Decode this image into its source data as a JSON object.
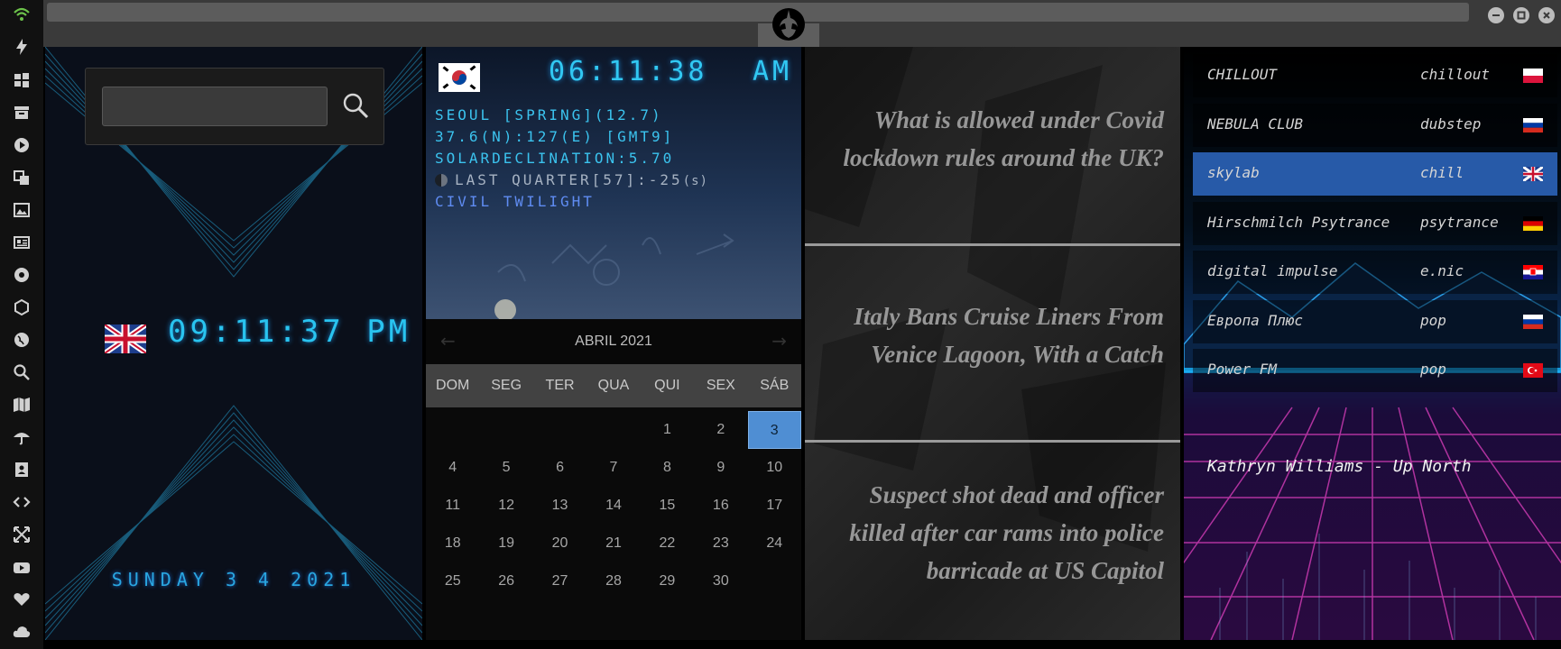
{
  "sidebar": {
    "icons": [
      "wifi-icon",
      "bolt-icon",
      "windows-icon",
      "archive-icon",
      "play-icon",
      "translate-icon",
      "image-icon",
      "news-icon",
      "rebel-icon",
      "hexagon-icon",
      "globe-icon",
      "search-icon",
      "map-icon",
      "umbrella-icon",
      "contacts-icon",
      "code-icon",
      "expand-icon",
      "youtube-icon",
      "heart-icon",
      "cloud-icon"
    ]
  },
  "colors": {
    "accent": "#29c4f0",
    "wifi": "#6cc24a",
    "selected": "#275aa8"
  },
  "clock": {
    "search": {
      "value": "",
      "placeholder": ""
    },
    "flag": "uk",
    "time": "09:11:37  PM",
    "date": "SUNDAY 3 4 2021"
  },
  "world": {
    "flag": "south-korea",
    "time": "06:11:38",
    "ampm": "AM",
    "city_line": "SEOUL [SPRING](12.7)",
    "coords_line": "37.6(N):127(E) [GMT9]",
    "declination_line": "SOLARDECLINATION:5.70",
    "moon_line": "LAST QUARTER[57]:-25",
    "moon_unit": "(s)",
    "twilight_line": "CIVIL TWILIGHT"
  },
  "calendar": {
    "title": "ABRIL 2021",
    "prev": "←",
    "next": "→",
    "weekdays": [
      "DOM",
      "SEG",
      "TER",
      "QUA",
      "QUI",
      "SEX",
      "SÁB"
    ],
    "rows": [
      [
        "",
        "",
        "",
        "",
        "1",
        "2",
        "3"
      ],
      [
        "4",
        "5",
        "6",
        "7",
        "8",
        "9",
        "10"
      ],
      [
        "11",
        "12",
        "13",
        "14",
        "15",
        "16",
        "17"
      ],
      [
        "18",
        "19",
        "20",
        "21",
        "22",
        "23",
        "24"
      ],
      [
        "25",
        "26",
        "27",
        "28",
        "29",
        "30",
        ""
      ]
    ],
    "today": "3"
  },
  "news": {
    "items": [
      "What is allowed under Covid lockdown rules around the UK?",
      "Italy Bans Cruise Liners From Venice Lagoon, With a Catch",
      "Suspect shot dead and officer killed after car rams into police barricade at US Capitol"
    ]
  },
  "radio": {
    "stations": [
      {
        "name": "CHILLOUT",
        "genre": "chillout",
        "flag": "poland"
      },
      {
        "name": "NEBULA CLUB",
        "genre": "dubstep",
        "flag": "russia"
      },
      {
        "name": "skylab",
        "genre": "chill",
        "flag": "uk"
      },
      {
        "name": "Hirschmilch Psytrance",
        "genre": "psytrance",
        "flag": "germany"
      },
      {
        "name": "digital impulse",
        "genre": "e.nic",
        "flag": "croatia"
      },
      {
        "name": "Европа Плюс",
        "genre": "pop",
        "flag": "russia"
      },
      {
        "name": "Power FM",
        "genre": "pop",
        "flag": "turkey"
      }
    ],
    "active_station": "skylab",
    "now_playing": "Kathryn Williams - Up North"
  }
}
